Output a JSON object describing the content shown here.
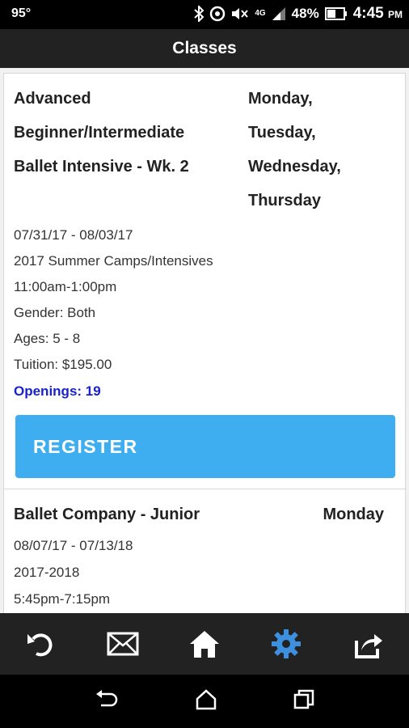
{
  "status_bar": {
    "temperature": "95°",
    "network": "4G",
    "battery": "48%",
    "time": "4:45",
    "time_suffix": "PM"
  },
  "header": {
    "title": "Classes"
  },
  "classes": [
    {
      "name_lines": [
        "Advanced",
        "Beginner/Intermediate",
        "Ballet Intensive - Wk. 2"
      ],
      "day_lines": [
        "Monday,",
        "Tuesday,",
        "Wednesday,",
        "Thursday"
      ],
      "dates": "07/31/17 - 08/03/17",
      "session": "2017 Summer Camps/Intensives",
      "time": "11:00am-1:00pm",
      "gender": "Gender: Both",
      "ages": "Ages: 5 - 8",
      "tuition": "Tuition: $195.00",
      "openings": "Openings: 19",
      "register_label": "REGISTER"
    },
    {
      "name": "Ballet Company - Junior",
      "days": "Monday",
      "dates": "08/07/17 - 07/13/18",
      "session": "2017-2018",
      "time": "5:45pm-7:15pm"
    }
  ],
  "tab_bar": {
    "icons": [
      "undo-icon",
      "mail-icon",
      "home-icon",
      "settings-icon",
      "share-icon"
    ],
    "active_color": "#3d8fe0",
    "inactive_color": "#ffffff"
  },
  "nav_bar": {
    "icons": [
      "back-icon",
      "home-icon",
      "recents-icon"
    ]
  }
}
